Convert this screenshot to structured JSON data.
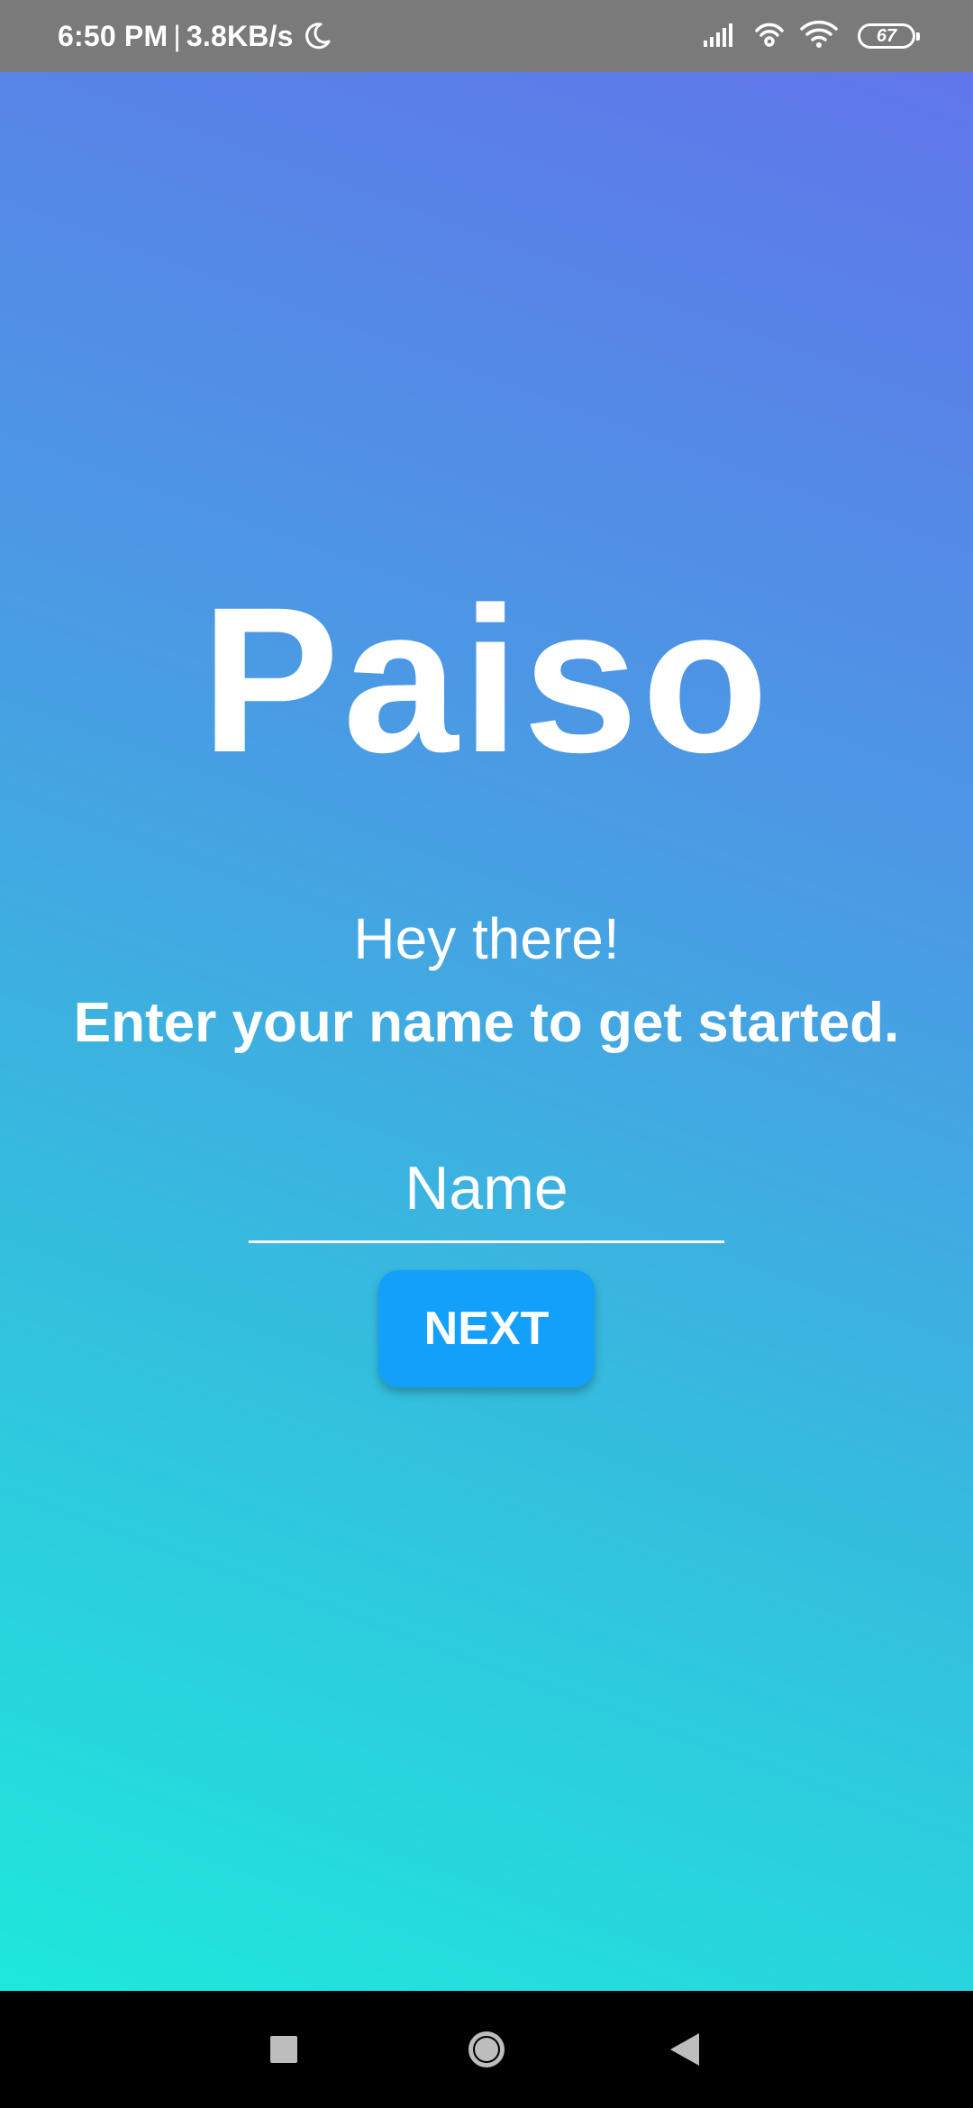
{
  "status_bar": {
    "time": "6:50 PM",
    "separator": "|",
    "network_speed": "3.8KB/s",
    "battery_level": "67",
    "icons": [
      "moon-icon",
      "signal-icon",
      "hotspot-icon",
      "wifi-icon",
      "battery-icon"
    ]
  },
  "main": {
    "app_title": "Paiso",
    "greeting": "Hey there!",
    "instruction": "Enter your name to get started.",
    "name_field": {
      "placeholder": "Name",
      "value": ""
    },
    "next_button_label": "NEXT",
    "colors": {
      "gradient_top": "#6076ea",
      "gradient_bottom": "#1ee8dc",
      "button": "#13a0fb"
    }
  },
  "nav_bar": {
    "icons": [
      "recents-icon",
      "home-icon",
      "back-icon"
    ]
  }
}
